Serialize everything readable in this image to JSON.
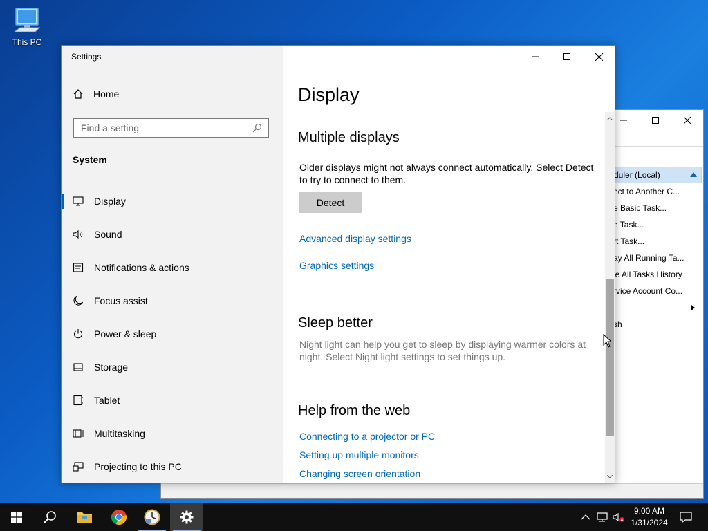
{
  "desktop": {
    "icons": [
      {
        "label": "This PC",
        "icon": "computer-icon"
      }
    ]
  },
  "background_window": {
    "actions": {
      "header": "duler (Local)",
      "items": [
        "ect to Another C...",
        "e Basic Task...",
        "e Task...",
        "rt Task...",
        "ay All Running Ta...",
        "le All Tasks History",
        "rvice Account Co...",
        "",
        "sh"
      ]
    }
  },
  "settings": {
    "title": "Settings",
    "home_label": "Home",
    "search_placeholder": "Find a setting",
    "section": "System",
    "nav": [
      {
        "label": "Display",
        "icon": "monitor-icon",
        "active": true
      },
      {
        "label": "Sound",
        "icon": "speaker-icon"
      },
      {
        "label": "Notifications & actions",
        "icon": "notification-icon"
      },
      {
        "label": "Focus assist",
        "icon": "moon-icon"
      },
      {
        "label": "Power & sleep",
        "icon": "power-icon"
      },
      {
        "label": "Storage",
        "icon": "storage-icon"
      },
      {
        "label": "Tablet",
        "icon": "tablet-icon"
      },
      {
        "label": "Multitasking",
        "icon": "multitasking-icon"
      },
      {
        "label": "Projecting to this PC",
        "icon": "projecting-icon"
      }
    ],
    "page": {
      "title": "Display",
      "multiple_displays": {
        "heading": "Multiple displays",
        "description": "Older displays might not always connect automatically. Select Detect to try to connect to them.",
        "detect_button": "Detect"
      },
      "links": {
        "advanced": "Advanced display settings",
        "graphics": "Graphics settings"
      },
      "sleep_better": {
        "heading": "Sleep better",
        "description": "Night light can help you get to sleep by displaying warmer colors at night. Select Night light settings to set things up."
      },
      "help": {
        "heading": "Help from the web",
        "links": [
          "Connecting to a projector or PC",
          "Setting up multiple monitors",
          "Changing screen orientation"
        ]
      }
    }
  },
  "taskbar": {
    "apps": [
      "start-icon",
      "search-icon",
      "file-explorer-icon",
      "chrome-icon",
      "task-scheduler-icon",
      "settings-gear-icon"
    ],
    "clock": {
      "time": "9:00 AM",
      "date": "1/31/2024"
    }
  },
  "colors": {
    "accent": "#0063b1",
    "link": "#0067b8",
    "taskbar": "#101010"
  }
}
